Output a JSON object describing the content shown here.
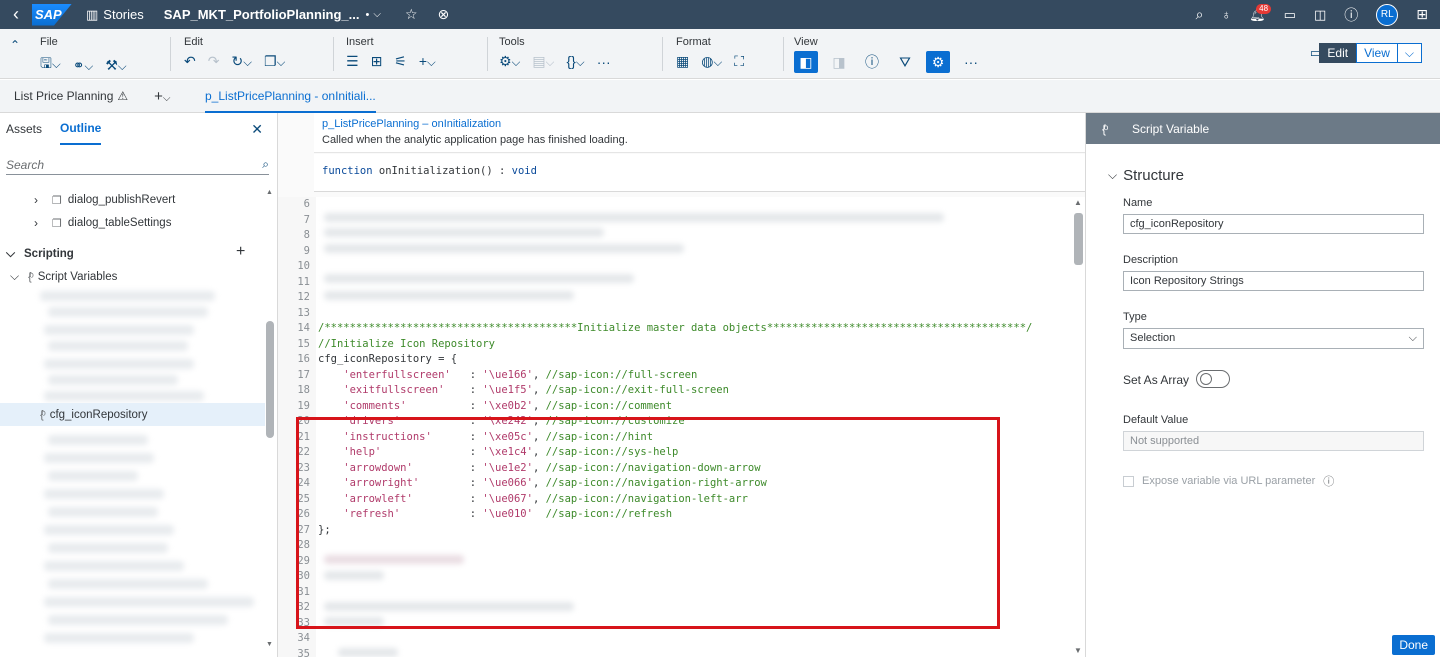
{
  "shell": {
    "stories_label": "Stories",
    "file_title": "SAP_MKT_PortfolioPlanning_...",
    "modified_marker": "•",
    "notification_count": "48",
    "avatar_initials": "RL"
  },
  "toolbar": {
    "groups": {
      "file": "File",
      "edit": "Edit",
      "insert": "Insert",
      "tools": "Tools",
      "format": "Format",
      "view": "View"
    },
    "mode_edit": "Edit",
    "mode_view": "View"
  },
  "tabbar": {
    "page_name": "List Price Planning",
    "script_tab": "p_ListPricePlanning - onInitiali..."
  },
  "left": {
    "tab_assets": "Assets",
    "tab_outline": "Outline",
    "search_placeholder": "Search",
    "items": {
      "dialog_publish": "dialog_publishRevert",
      "dialog_table": "dialog_tableSettings",
      "scripting": "Scripting",
      "script_variables": "Script Variables",
      "selected_var": "cfg_iconRepository"
    }
  },
  "editor": {
    "function_path": "p_ListPricePlanning – onInitialization",
    "description": "Called when the analytic application page has finished loading.",
    "signature_kw1": "function",
    "signature_name": " onInitialization() : ",
    "signature_kw2": "void",
    "lines": {
      "n6": "6",
      "n7": "7",
      "n8": "8",
      "n9": "9",
      "n10": "10",
      "n11": "11",
      "n12": "12",
      "n13": "13",
      "n14": "14",
      "n15": "15",
      "n16": "16",
      "n17": "17",
      "n18": "18",
      "n19": "19",
      "n20": "20",
      "n21": "21",
      "n22": "22",
      "n23": "23",
      "n24": "24",
      "n25": "25",
      "n26": "26",
      "n27": "27",
      "n28": "28",
      "n29": "29",
      "n30": "30",
      "n31": "31",
      "n32": "32",
      "n33": "33",
      "n34": "34",
      "n35": "35"
    },
    "code": {
      "l14": "/****************************************Initialize master data objects*****************************************/",
      "l15": "//Initialize Icon Repository",
      "l16": "cfg_iconRepository = {",
      "l27": "};",
      "entries": [
        {
          "key": "    'enterfullscreen'   ",
          "val": "'\\ue166'",
          "sep": ", ",
          "cmt": "//sap-icon://full-screen"
        },
        {
          "key": "    'exitfullscreen'    ",
          "val": "'\\ue1f5'",
          "sep": ", ",
          "cmt": "//sap-icon://exit-full-screen"
        },
        {
          "key": "    'comments'          ",
          "val": "'\\xe0b2'",
          "sep": ", ",
          "cmt": "//sap-icon://comment"
        },
        {
          "key": "    'drivers'           ",
          "val": "'\\xe242'",
          "sep": ", ",
          "cmt": "//sap-icon://customize"
        },
        {
          "key": "    'instructions'      ",
          "val": "'\\xe05c'",
          "sep": ", ",
          "cmt": "//sap-icon://hint"
        },
        {
          "key": "    'help'              ",
          "val": "'\\xe1c4'",
          "sep": ", ",
          "cmt": "//sap-icon://sys-help"
        },
        {
          "key": "    'arrowdown'         ",
          "val": "'\\ue1e2'",
          "sep": ", ",
          "cmt": "//sap-icon://navigation-down-arrow"
        },
        {
          "key": "    'arrowright'        ",
          "val": "'\\ue066'",
          "sep": ", ",
          "cmt": "//sap-icon://navigation-right-arrow"
        },
        {
          "key": "    'arrowleft'         ",
          "val": "'\\ue067'",
          "sep": ", ",
          "cmt": "//sap-icon://navigation-left-arr"
        },
        {
          "key": "    'refresh'           ",
          "val": "'\\ue010'",
          "sep": "  ",
          "cmt": "//sap-icon://refresh"
        }
      ]
    },
    "sep": ": "
  },
  "right": {
    "header": "Script Variable",
    "section": "Structure",
    "name_label": "Name",
    "name_value": "cfg_iconRepository",
    "description_label": "Description",
    "description_value": "Icon Repository Strings",
    "type_label": "Type",
    "type_value": "Selection",
    "array_label": "Set As Array",
    "default_label": "Default Value",
    "default_value": "Not supported",
    "expose_label": "Expose variable via URL parameter",
    "done_label": "Done"
  },
  "colors": {
    "shell": "#354a5f",
    "accent": "#0a6ed1",
    "highlight_box": "#d7141a",
    "comment": "#3d8a2a",
    "string": "#b03a6a"
  }
}
